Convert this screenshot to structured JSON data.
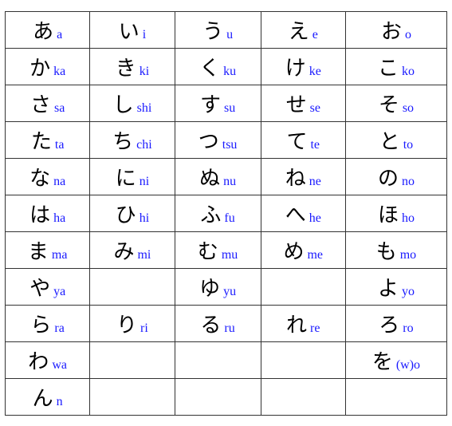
{
  "table": {
    "rows": [
      [
        {
          "kana": "あ",
          "romaji": "a"
        },
        {
          "kana": "い",
          "romaji": "i"
        },
        {
          "kana": "う",
          "romaji": "u"
        },
        {
          "kana": "え",
          "romaji": "e"
        },
        {
          "kana": "お",
          "romaji": "o"
        }
      ],
      [
        {
          "kana": "か",
          "romaji": "ka"
        },
        {
          "kana": "き",
          "romaji": "ki"
        },
        {
          "kana": "く",
          "romaji": "ku"
        },
        {
          "kana": "け",
          "romaji": "ke"
        },
        {
          "kana": "こ",
          "romaji": "ko"
        }
      ],
      [
        {
          "kana": "さ",
          "romaji": "sa"
        },
        {
          "kana": "し",
          "romaji": "shi"
        },
        {
          "kana": "す",
          "romaji": "su"
        },
        {
          "kana": "せ",
          "romaji": "se"
        },
        {
          "kana": "そ",
          "romaji": "so"
        }
      ],
      [
        {
          "kana": "た",
          "romaji": "ta"
        },
        {
          "kana": "ち",
          "romaji": "chi"
        },
        {
          "kana": "つ",
          "romaji": "tsu"
        },
        {
          "kana": "て",
          "romaji": "te"
        },
        {
          "kana": "と",
          "romaji": "to"
        }
      ],
      [
        {
          "kana": "な",
          "romaji": "na"
        },
        {
          "kana": "に",
          "romaji": "ni"
        },
        {
          "kana": "ぬ",
          "romaji": "nu"
        },
        {
          "kana": "ね",
          "romaji": "ne"
        },
        {
          "kana": "の",
          "romaji": "no"
        }
      ],
      [
        {
          "kana": "は",
          "romaji": "ha"
        },
        {
          "kana": "ひ",
          "romaji": "hi"
        },
        {
          "kana": "ふ",
          "romaji": "fu"
        },
        {
          "kana": "へ",
          "romaji": "he"
        },
        {
          "kana": "ほ",
          "romaji": "ho"
        }
      ],
      [
        {
          "kana": "ま",
          "romaji": "ma"
        },
        {
          "kana": "み",
          "romaji": "mi"
        },
        {
          "kana": "む",
          "romaji": "mu"
        },
        {
          "kana": "め",
          "romaji": "me"
        },
        {
          "kana": "も",
          "romaji": "mo"
        }
      ],
      [
        {
          "kana": "や",
          "romaji": "ya"
        },
        {
          "kana": "",
          "romaji": ""
        },
        {
          "kana": "ゆ",
          "romaji": "yu"
        },
        {
          "kana": "",
          "romaji": ""
        },
        {
          "kana": "よ",
          "romaji": "yo"
        }
      ],
      [
        {
          "kana": "ら",
          "romaji": "ra"
        },
        {
          "kana": "り",
          "romaji": "ri"
        },
        {
          "kana": "る",
          "romaji": "ru"
        },
        {
          "kana": "れ",
          "romaji": "re"
        },
        {
          "kana": "ろ",
          "romaji": "ro"
        }
      ],
      [
        {
          "kana": "わ",
          "romaji": "wa"
        },
        {
          "kana": "",
          "romaji": ""
        },
        {
          "kana": "",
          "romaji": ""
        },
        {
          "kana": "",
          "romaji": ""
        },
        {
          "kana": "を",
          "romaji": "(w)o"
        }
      ],
      [
        {
          "kana": "ん",
          "romaji": "n"
        },
        {
          "kana": "",
          "romaji": ""
        },
        {
          "kana": "",
          "romaji": ""
        },
        {
          "kana": "",
          "romaji": ""
        },
        {
          "kana": "",
          "romaji": ""
        }
      ]
    ]
  }
}
